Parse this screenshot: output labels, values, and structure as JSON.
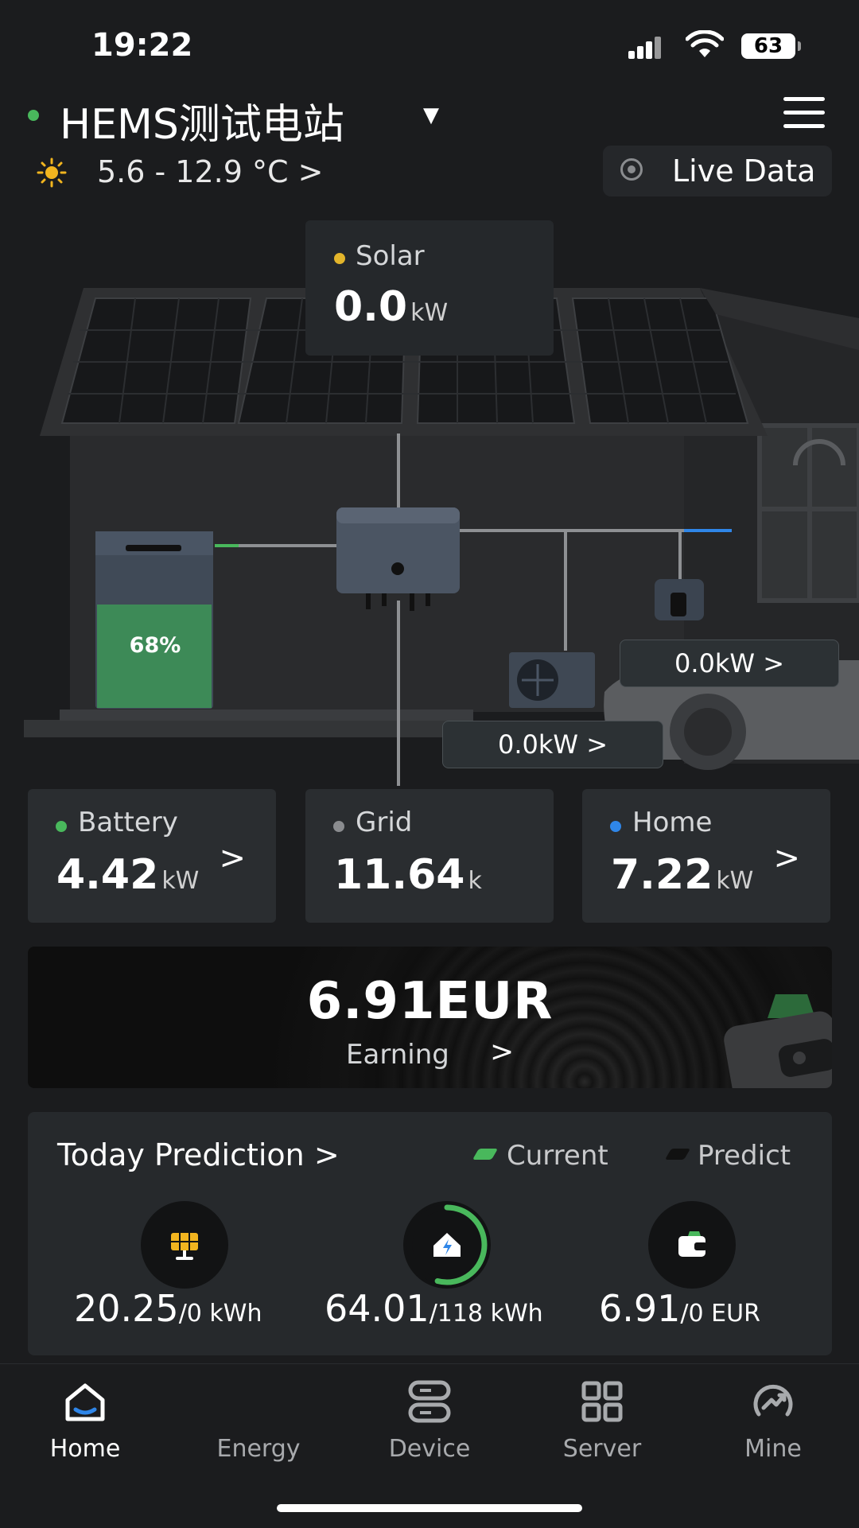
{
  "status_bar": {
    "time": "19:22",
    "battery": "63"
  },
  "header": {
    "station_name": "HEMS测试电站",
    "weather": "5.6 - 12.9 °C >",
    "live_data": "Live Data"
  },
  "scene": {
    "solar": {
      "label": "Solar",
      "value": "0.0",
      "unit": "kW"
    },
    "battery_soc": "68%",
    "ev_power": "0.0kW >",
    "heatpump_power": "0.0kW >"
  },
  "stats": [
    {
      "label": "Battery",
      "value": "4.42",
      "unit": "kW",
      "dot_color": "#49b85c"
    },
    {
      "label": "Grid",
      "value": "11.64",
      "unit": "k",
      "dot_color": "#8a8c8f"
    },
    {
      "label": "Home",
      "value": "7.22",
      "unit": "kW",
      "dot_color": "#2f86e8"
    }
  ],
  "earnings": {
    "value": "6.91EUR",
    "label": "Earning"
  },
  "prediction": {
    "title": "Today Prediction >",
    "legend_current": "Current",
    "legend_predict": "Predict",
    "items": [
      {
        "icon": "solar-panel-icon",
        "value": "20.25",
        "target": "/0 kWh",
        "progress": 0
      },
      {
        "icon": "home-energy-icon",
        "value": "64.01",
        "target": "/118 kWh",
        "progress": 0.54
      },
      {
        "icon": "wallet-icon",
        "value": "6.91",
        "target": "/0 EUR",
        "progress": 0
      }
    ]
  },
  "tabs": [
    {
      "label": "Home",
      "icon": "home-icon",
      "active": true
    },
    {
      "label": "Energy",
      "icon": "energy-icon",
      "active": false
    },
    {
      "label": "Device",
      "icon": "device-icon",
      "active": false
    },
    {
      "label": "Server",
      "icon": "server-icon",
      "active": false
    },
    {
      "label": "Mine",
      "icon": "mine-icon",
      "active": false
    }
  ],
  "colors": {
    "accent_green": "#49b85c",
    "solar_yellow": "#e3b52b",
    "home_blue": "#2f86e8"
  }
}
